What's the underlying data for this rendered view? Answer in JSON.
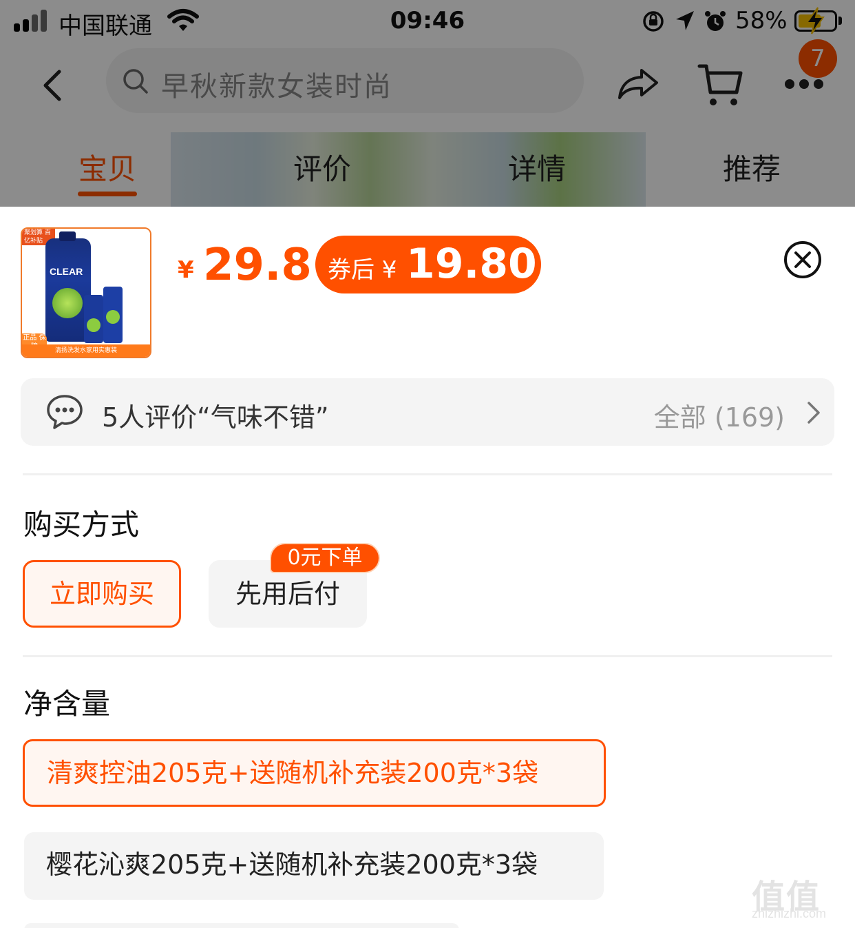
{
  "status_bar": {
    "carrier": "中国联通",
    "time": "09:46",
    "battery_percent": "58%"
  },
  "search": {
    "placeholder": "早秋新款女装时尚"
  },
  "nav": {
    "notification_count": "7"
  },
  "tabs": [
    {
      "label": "宝贝",
      "active": true
    },
    {
      "label": "评价",
      "active": false
    },
    {
      "label": "详情",
      "active": false
    },
    {
      "label": "推荐",
      "active": false
    }
  ],
  "product": {
    "thumb_badge_top": "聚划算 百亿补贴",
    "thumb_badge_left": "正品 保障",
    "thumb_brand": "CLEAR",
    "thumb_caption": "清扬洗发水家用实惠装",
    "price_currency": "¥",
    "price": "29.8",
    "coupon_label": "券后 ¥",
    "coupon_price": "19.80"
  },
  "reviews": {
    "summary": "5人评价“气味不错”",
    "all_label": "全部 (169)"
  },
  "purchase": {
    "title": "购买方式",
    "options": [
      {
        "label": "立即购买",
        "selected": true
      },
      {
        "label": "先用后付",
        "selected": false,
        "badge": "0元下单"
      }
    ]
  },
  "net_content": {
    "title": "净含量",
    "options": [
      {
        "label": "清爽控油205克+送随机补充装200克*3袋",
        "selected": true
      },
      {
        "label": "樱花沁爽205克+送随机补充装200克*3袋",
        "selected": false
      }
    ]
  },
  "watermark": {
    "glyphs": "值值值",
    "url": "zhizhizhi.com"
  },
  "colors": {
    "accent": "#ff5000",
    "selected_bg": "#fff6f1",
    "chip_bg": "#f4f4f4"
  }
}
